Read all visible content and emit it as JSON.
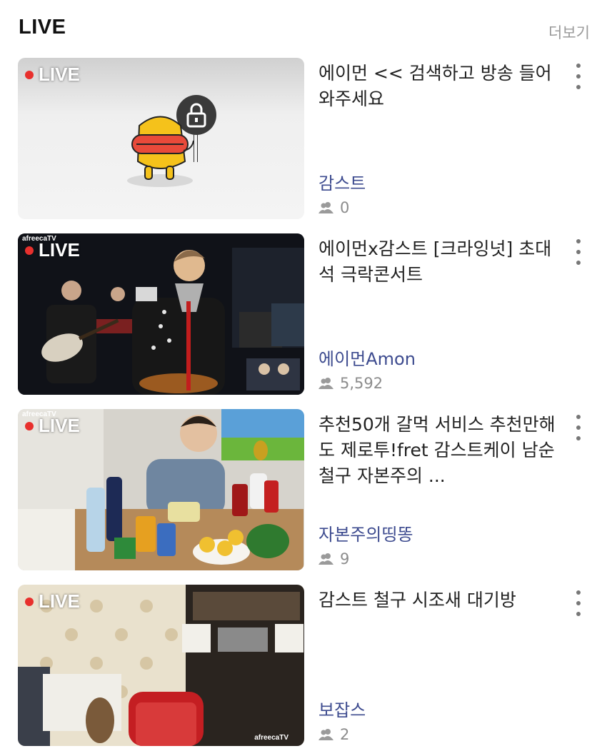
{
  "header": {
    "title": "LIVE",
    "more": "더보기"
  },
  "streams": [
    {
      "live": "LIVE",
      "title": "에이먼 << 검색하고 방송 들어와주세요",
      "channel": "감스트",
      "viewers": "0"
    },
    {
      "live": "LIVE",
      "title": "에이먼x감스트 [크라잉넛] 초대석 극락콘서트",
      "channel": "에이먼Amon",
      "viewers": "5,592"
    },
    {
      "live": "LIVE",
      "title": "추천50개 갈먹 서비스 추천만해도 제로투!fret 감스트케이 남순 철구 자본주의 ...",
      "channel": "자본주의띵똥",
      "viewers": "9"
    },
    {
      "live": "LIVE",
      "title": "감스트 철구 시조새 대기방",
      "channel": "보잡스",
      "viewers": "2"
    }
  ],
  "watermark": "afreecaTV",
  "icons": {
    "viewers": "people-icon",
    "more": "kebab-menu-icon",
    "lock": "lock-icon"
  },
  "colors": {
    "live_dot": "#e8302d",
    "channel": "#3d4b8f",
    "meta": "#8c8c8c"
  }
}
